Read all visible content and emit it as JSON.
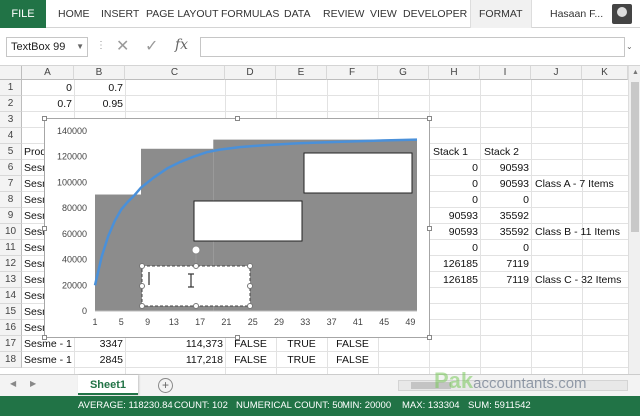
{
  "ribbon": {
    "file": "FILE",
    "tabs": [
      "HOME",
      "INSERT",
      "PAGE LAYOUT",
      "FORMULAS",
      "DATA",
      "REVIEW",
      "VIEW",
      "DEVELOPER"
    ],
    "context_tab": "FORMAT",
    "user": "Hasaan F..."
  },
  "formula_bar": {
    "name_box": "TextBox 99",
    "fx": "fx",
    "formula": ""
  },
  "columns": [
    "A",
    "B",
    "C",
    "D",
    "E",
    "F",
    "G",
    "H",
    "I",
    "J",
    "K"
  ],
  "rows": [
    "1",
    "2",
    "3",
    "4",
    "5",
    "6",
    "7",
    "8",
    "9",
    "10",
    "11",
    "12",
    "13",
    "14",
    "15",
    "16",
    "17",
    "18"
  ],
  "cells": {
    "r1": {
      "A": "0",
      "B": "0.7"
    },
    "r2": {
      "A": "0.7",
      "B": "0.95"
    },
    "r5": {
      "A": "Prod",
      "H": "Stack 1",
      "I": "Stack 2"
    },
    "r6": {
      "A": "Sesm",
      "H": "0",
      "I": "90593"
    },
    "r7": {
      "A": "Sesm",
      "H": "0",
      "I": "90593",
      "J": "Class A - 7 Items"
    },
    "r8": {
      "A": "Sesm",
      "H": "0",
      "I": "0"
    },
    "r9": {
      "A": "Sesm",
      "H": "90593",
      "I": "35592"
    },
    "r10": {
      "A": "Sesm",
      "H": "90593",
      "I": "35592",
      "J": "Class B - 11 Items"
    },
    "r11": {
      "A": "Sesm",
      "H": "0",
      "I": "0"
    },
    "r12": {
      "A": "Sesm",
      "H": "126185",
      "I": "7119"
    },
    "r13": {
      "A": "Sesm",
      "H": "126185",
      "I": "7119",
      "J": "Class C - 32 Items"
    },
    "r14": {
      "A": "Sesm"
    },
    "r15": {
      "A": "Sesm"
    },
    "r16": {
      "A": "Sesm"
    },
    "r17": {
      "A": "Sesme - 1",
      "B": "3347",
      "C": "114,373",
      "D": "FALSE",
      "E": "TRUE",
      "F": "FALSE"
    },
    "r18": {
      "A": "Sesme - 1",
      "B": "2845",
      "C": "117,218",
      "D": "FALSE",
      "E": "TRUE",
      "F": "FALSE"
    }
  },
  "chart_data": {
    "type": "area",
    "ylim": [
      0,
      140000
    ],
    "yticks": [
      "0",
      "20000",
      "40000",
      "60000",
      "80000",
      "100000",
      "120000",
      "140000"
    ],
    "xticks": [
      "1",
      "5",
      "9",
      "13",
      "17",
      "21",
      "25",
      "29",
      "33",
      "37",
      "41",
      "45",
      "49"
    ],
    "xlim": [
      1,
      50
    ],
    "bands": [
      {
        "x_start": 1,
        "x_end": 8,
        "value": 90593
      },
      {
        "x_start": 8,
        "x_end": 19,
        "value": 126185
      },
      {
        "x_start": 19,
        "x_end": 50,
        "value": 133304
      }
    ],
    "curve": [
      [
        1,
        20000
      ],
      [
        2,
        42000
      ],
      [
        3,
        58000
      ],
      [
        4,
        70000
      ],
      [
        5,
        79000
      ],
      [
        6,
        85000
      ],
      [
        7,
        90000
      ],
      [
        8,
        96000
      ],
      [
        10,
        104000
      ],
      [
        12,
        111000
      ],
      [
        14,
        116000
      ],
      [
        16,
        120000
      ],
      [
        18,
        123500
      ],
      [
        20,
        125500
      ],
      [
        23,
        127500
      ],
      [
        27,
        129000
      ],
      [
        32,
        130500
      ],
      [
        38,
        131500
      ],
      [
        44,
        132500
      ],
      [
        50,
        133304
      ]
    ],
    "colors": {
      "band": "#8c8c8c",
      "curve": "#4a90d9"
    }
  },
  "sheet_tabs": {
    "active": "Sheet1",
    "add": "+"
  },
  "status_bar": {
    "average": "AVERAGE: 118230.84",
    "count": "COUNT: 102",
    "numerical_count": "NUMERICAL COUNT: 50",
    "min": "MIN: 20000",
    "max": "MAX: 133304",
    "sum": "SUM: 5911542"
  },
  "watermark": {
    "main": "Pak",
    "sub": "accountants.com"
  }
}
